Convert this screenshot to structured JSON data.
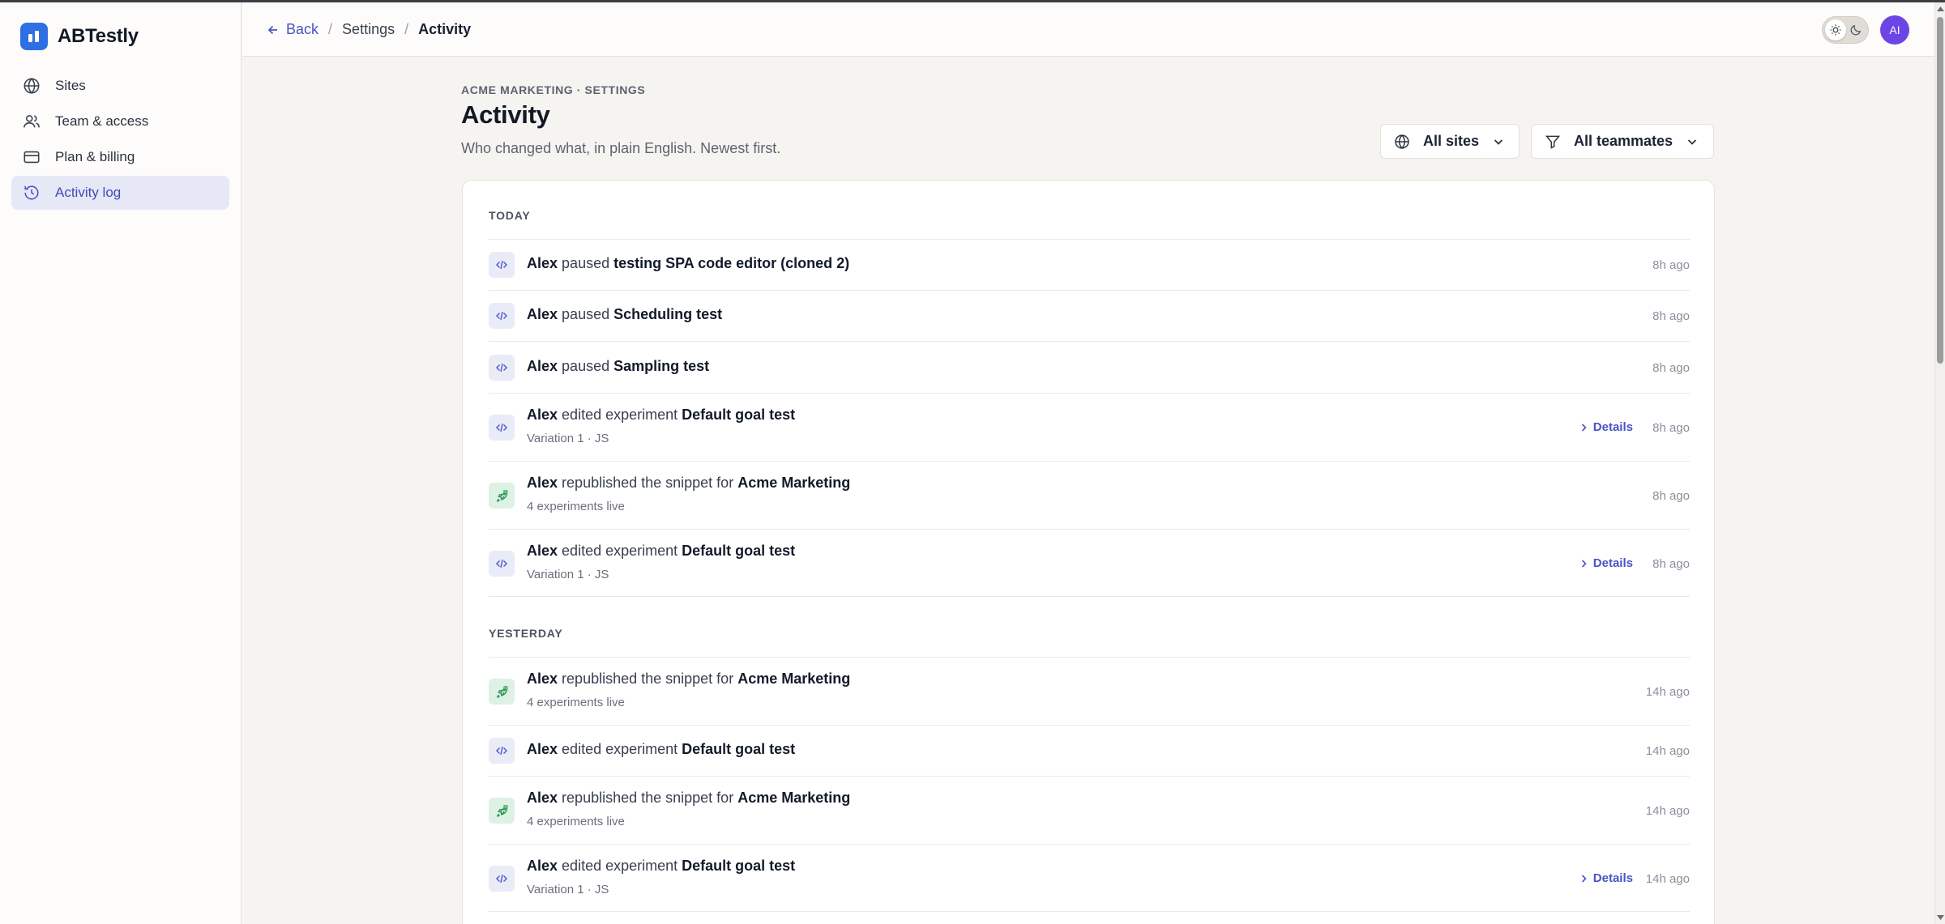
{
  "app": {
    "name": "ABTestly"
  },
  "sidebar": {
    "items": [
      {
        "label": "Sites",
        "icon": "globe-icon"
      },
      {
        "label": "Team & access",
        "icon": "users-icon"
      },
      {
        "label": "Plan & billing",
        "icon": "credit-card-icon"
      },
      {
        "label": "Activity log",
        "icon": "history-icon",
        "active": true
      }
    ]
  },
  "topbar": {
    "back_label": "Back",
    "crumb_settings": "Settings",
    "crumb_current": "Activity",
    "avatar_initials": "AI"
  },
  "header": {
    "eyebrow": "ACME MARKETING · SETTINGS",
    "title": "Activity",
    "subtitle": "Who changed what, in plain English. Newest first."
  },
  "filters": {
    "sites_label": "All sites",
    "team_label": "All teammates"
  },
  "details_label": "Details",
  "sections": [
    {
      "label": "TODAY",
      "rows": [
        {
          "actor": "Alex",
          "verb": "paused",
          "target": "testing SPA code editor (cloned 2)",
          "time": "8h ago",
          "kind": "code"
        },
        {
          "actor": "Alex",
          "verb": "paused",
          "target": "Scheduling test",
          "time": "8h ago",
          "kind": "code"
        },
        {
          "actor": "Alex",
          "verb": "paused",
          "target": "Sampling test",
          "time": "8h ago",
          "kind": "code"
        },
        {
          "actor": "Alex",
          "verb": "edited experiment",
          "target": "Default goal test",
          "sub": "Variation 1 · JS",
          "time": "8h ago",
          "kind": "code",
          "details": true
        },
        {
          "actor": "Alex",
          "verb": "republished the snippet for",
          "target": "Acme Marketing",
          "sub": "4 experiments live",
          "time": "8h ago",
          "kind": "rocket"
        },
        {
          "actor": "Alex",
          "verb": "edited experiment",
          "target": "Default goal test",
          "sub": "Variation 1 · JS",
          "time": "8h ago",
          "kind": "code",
          "details": true
        }
      ]
    },
    {
      "label": "YESTERDAY",
      "rows": [
        {
          "actor": "Alex",
          "verb": "republished the snippet for",
          "target": "Acme Marketing",
          "sub": "4 experiments live",
          "time": "14h ago",
          "kind": "rocket"
        },
        {
          "actor": "Alex",
          "verb": "edited experiment",
          "target": "Default goal test",
          "time": "14h ago",
          "kind": "code"
        },
        {
          "actor": "Alex",
          "verb": "republished the snippet for",
          "target": "Acme Marketing",
          "sub": "4 experiments live",
          "time": "14h ago",
          "kind": "rocket"
        },
        {
          "actor": "Alex",
          "verb": "edited experiment",
          "target": "Default goal test",
          "sub": "Variation 1 · JS",
          "time": "14h ago",
          "kind": "code",
          "details": true
        }
      ]
    }
  ],
  "colors": {
    "accent": "#4954c4",
    "brand": "#2f6fe4",
    "avatar": "#6d45e6",
    "active_nav_bg": "#e6e8f6"
  }
}
